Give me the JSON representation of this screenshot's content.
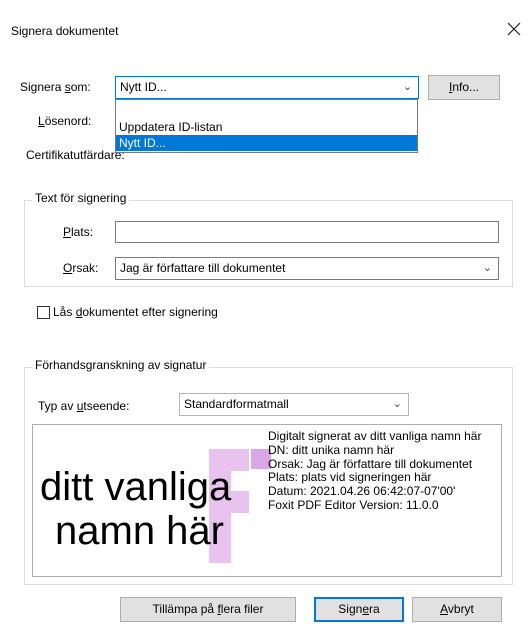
{
  "dialog": {
    "title": "Signera dokumentet",
    "close_glyph": "×"
  },
  "sign_as": {
    "label_pre": "Signera ",
    "label_access": "s",
    "label_post": "om:",
    "value": "Nytt ID...",
    "dropdown_items": [
      "Uppdatera ID-listan",
      "Nytt ID..."
    ],
    "selected_index": 1
  },
  "info_button": {
    "access": "I",
    "rest": "nfo..."
  },
  "password": {
    "label_access": "L",
    "label_rest": "ösenord:"
  },
  "cert_issuer": {
    "label": "Certifikatutfärdare:"
  },
  "signing_text": {
    "legend": "Text för signering",
    "place_label_access": "P",
    "place_label_rest": "lats:",
    "place_value": "",
    "reason_label_access": "O",
    "reason_label_rest": "rsak:",
    "reason_value": "Jag är författare till dokumentet"
  },
  "lock": {
    "label_pre": "Lås ",
    "label_access": "d",
    "label_post": "okumentet efter signering",
    "checked": false
  },
  "preview": {
    "legend": "Förhandsgranskning av signatur",
    "appearance_label_pre": "Typ av ",
    "appearance_label_access": "u",
    "appearance_label_post": "tseende:",
    "appearance_value": "Standardformatmall",
    "name_line1": "ditt vanliga",
    "name_line2": "namn här",
    "details": [
      "Digitalt signerat av ditt vanliga namn här",
      "DN: ditt unika namn här",
      "Orsak: Jag är författare till dokumentet",
      "Plats: plats vid signeringen här",
      "Datum: 2021.04.26 06:42:07-07'00'",
      "Foxit PDF Editor Version: 11.0.0"
    ],
    "logo_color": "#c58ad6"
  },
  "buttons": {
    "apply_pre": "Tillämpa på ",
    "apply_access": "f",
    "apply_post": "lera filer",
    "sign_pre": "Sign",
    "sign_access": "e",
    "sign_post": "ra",
    "cancel_access": "A",
    "cancel_rest": "vbryt"
  },
  "colors": {
    "accent": "#0078d7",
    "selection": "#0078d7"
  },
  "icons": {
    "close": "close-icon",
    "chevron": "chevron-down-icon"
  }
}
